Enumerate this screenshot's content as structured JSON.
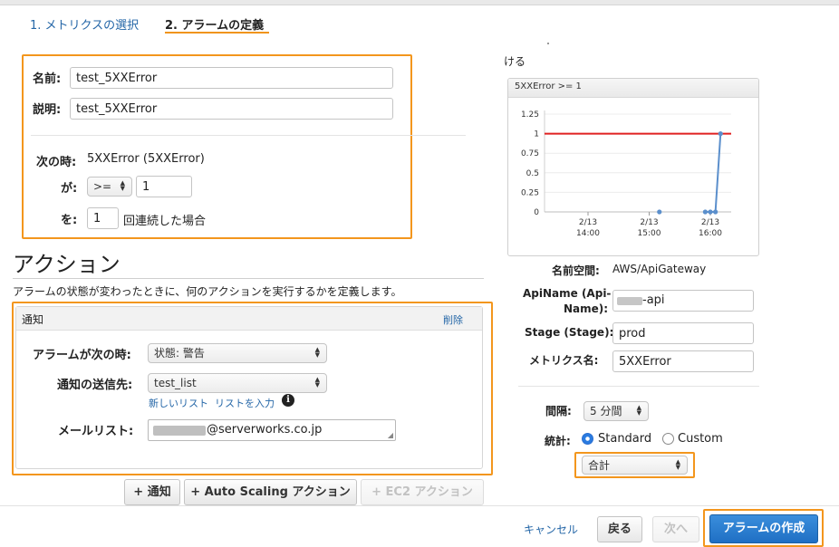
{
  "wizard": {
    "step1": "1. メトリクスの選択",
    "step2": "2. アラームの定義"
  },
  "alarm": {
    "name_label": "名前:",
    "name_value": "test_5XXError",
    "desc_label": "説明:",
    "desc_value": "test_5XXError",
    "when_label": "次の時:",
    "when_value": "5XXError (5XXError)",
    "is_label": "が:",
    "operator": ">=",
    "threshold": "1",
    "for_label": "を:",
    "periods": "1",
    "periods_suffix": "回連続した場合"
  },
  "actions": {
    "heading": "アクション",
    "description": "アラームの状態が変わったときに、何のアクションを実行するかを定義します。",
    "notification": {
      "title": "通知",
      "delete_link": "削除",
      "state_label": "アラームが次の時:",
      "state_value": "状態: 警告",
      "send_to_label": "通知の送信先:",
      "send_to_value": "test_list",
      "new_list_link": "新しいリスト",
      "enter_list_link": "リストを入力",
      "email_label": "メールリスト:",
      "email_value": "@serverworks.co.jp"
    },
    "add_notification": "+ 通知",
    "add_autoscaling": "+ Auto Scaling アクション",
    "add_ec2": "+ EC2 アクション"
  },
  "preview": {
    "heading_partial": "ける",
    "chart_title": "5XXError >= 1",
    "namespace_label": "名前空間:",
    "namespace_value": "AWS/ApiGateway",
    "apiname_label_1": "ApiName (Api-",
    "apiname_label_2": "Name):",
    "apiname_value": "-api",
    "stage_label": "Stage (Stage):",
    "stage_value": "prod",
    "metric_label": "メトリクス名:",
    "metric_value": "5XXError",
    "period_label": "間隔:",
    "period_value": "5 分間",
    "stat_label": "統計:",
    "stat_standard": "Standard",
    "stat_custom": "Custom",
    "stat_value": "合計"
  },
  "footer": {
    "cancel": "キャンセル",
    "back": "戻る",
    "next": "次へ",
    "create": "アラームの作成"
  },
  "chart_data": {
    "type": "line",
    "title": "5XXError >= 1",
    "yticks": [
      "1.25",
      "1",
      "0.75",
      "0.5",
      "0.25",
      "0"
    ],
    "ylim": [
      0,
      1.25
    ],
    "xticks": [
      {
        "date": "2/13",
        "time": "14:00"
      },
      {
        "date": "2/13",
        "time": "15:00"
      },
      {
        "date": "2/13",
        "time": "16:00"
      }
    ],
    "threshold": 1,
    "series": [
      {
        "x": [
          "15:10",
          "15:55",
          "16:00",
          "16:05",
          "16:10"
        ],
        "values": [
          0,
          0,
          0,
          0,
          1
        ]
      }
    ],
    "colors": {
      "threshold": "#e02020",
      "series": "#5b8fcc"
    }
  },
  "colors": {
    "accent": "#f3961d",
    "link": "#2466a7",
    "primary": "#2a7be0"
  }
}
